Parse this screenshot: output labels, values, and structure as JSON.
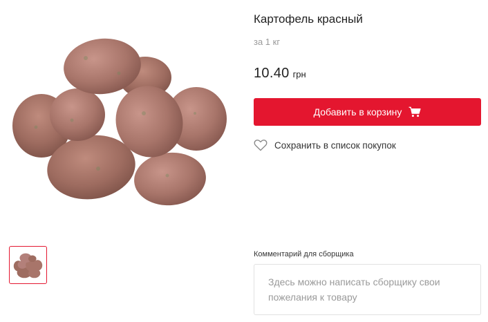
{
  "product": {
    "title": "Картофель красный",
    "unit": "за 1 кг",
    "price_value": "10.40",
    "price_currency": "грн",
    "image_alt": "potatoes-photo"
  },
  "actions": {
    "add_to_cart_label": "Добавить в корзину",
    "add_to_cart_icon": "cart-icon",
    "save_label": "Сохранить в список покупок",
    "save_icon": "heart-icon"
  },
  "comment": {
    "label": "Комментарий для сборщика",
    "placeholder": "Здесь можно написать сборщику свои пожелания к товару"
  },
  "colors": {
    "accent": "#e4162f",
    "text": "#222222",
    "muted": "#9a9a9a",
    "border": "#e1e1e1"
  }
}
